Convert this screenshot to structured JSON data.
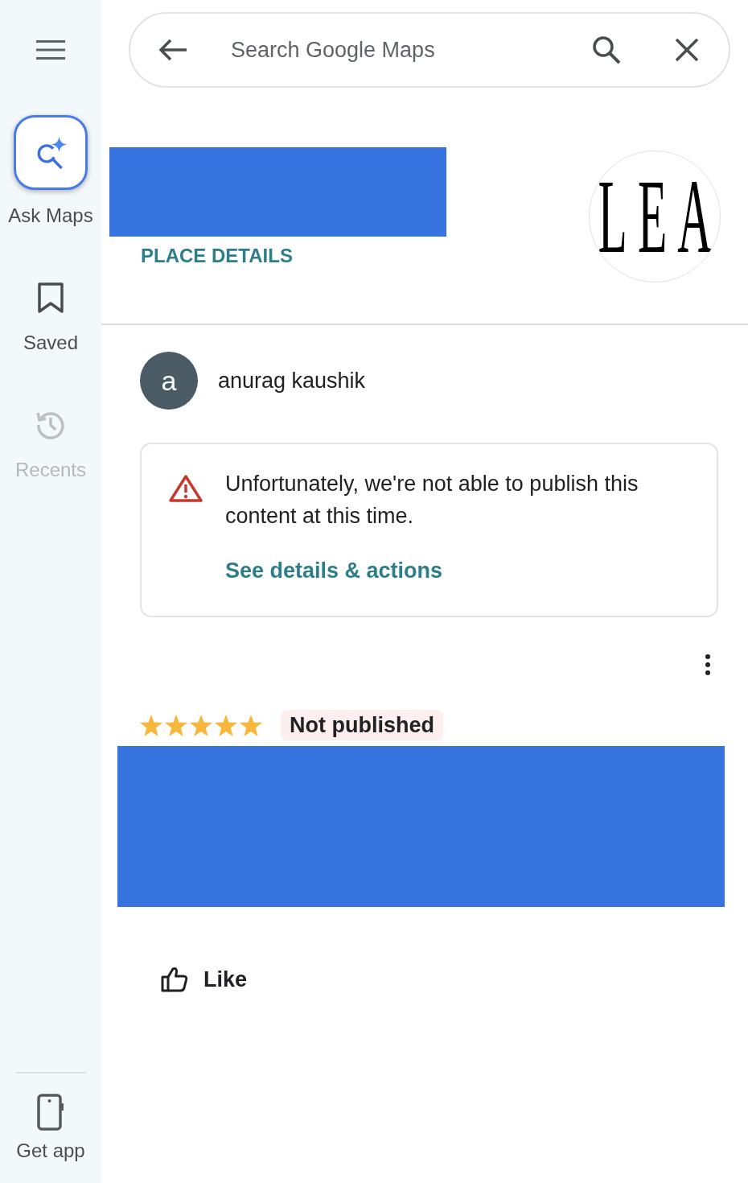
{
  "sidebar": {
    "ask_button": {
      "label": "Ask Maps"
    },
    "items": [
      {
        "label": "Saved",
        "disabled": false
      },
      {
        "label": "Recents",
        "disabled": true
      }
    ],
    "footer_item": {
      "label": "Get app"
    }
  },
  "search": {
    "placeholder": "Search Google Maps"
  },
  "place": {
    "name_redacted": true,
    "link": "PLACE DETAILS",
    "logo_text": "LEA"
  },
  "review": {
    "author": {
      "initial": "a",
      "name": "anurag kaushik"
    },
    "notice": {
      "message": "Unfortunately, we're not able to publish this content at this time.",
      "link": "See details & actions"
    },
    "stars": 5,
    "status": "Not published",
    "text_redacted": true,
    "actions": [
      {
        "label": "Like"
      }
    ]
  }
}
